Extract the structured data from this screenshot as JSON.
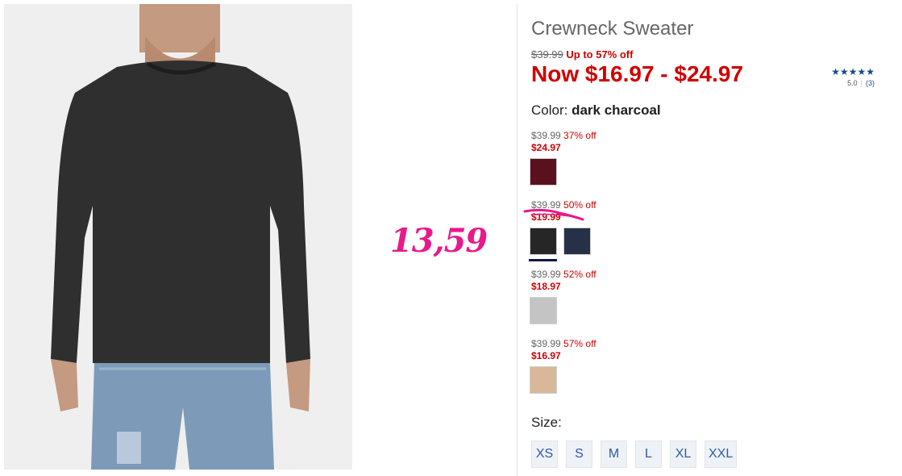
{
  "product": {
    "title": "Crewneck Sweater",
    "list_price": "$39.99",
    "discount_summary": "Up to 57% off",
    "now_range": "Now $16.97 - $24.97",
    "rating": {
      "stars": "★★★★★",
      "score": "5.0",
      "separator": "|",
      "count": "(3)"
    },
    "color_label": "Color:",
    "color_value": "dark charcoal"
  },
  "annotation": "13,59",
  "price_groups": [
    {
      "orig": "$39.99",
      "pct": "37% off",
      "sale": "$24.97",
      "swatches": [
        {
          "name": "burgundy",
          "color": "#5b1020"
        }
      ]
    },
    {
      "orig": "$39.99",
      "pct": "50% off",
      "sale": "$19.99",
      "swatches": [
        {
          "name": "dark charcoal",
          "color": "#262626",
          "selected": true
        },
        {
          "name": "navy",
          "color": "#263148"
        }
      ]
    },
    {
      "orig": "$39.99",
      "pct": "52% off",
      "sale": "$18.97",
      "swatches": [
        {
          "name": "light heather grey",
          "color": "#c4c4c4"
        }
      ]
    },
    {
      "orig": "$39.99",
      "pct": "57% off",
      "sale": "$16.97",
      "swatches": [
        {
          "name": "camel",
          "color": "#d8b898"
        }
      ]
    }
  ],
  "size": {
    "label": "Size:",
    "options": [
      "XS",
      "S",
      "M",
      "L",
      "XL",
      "XXL"
    ]
  },
  "colors": {
    "sale_red": "#d00000",
    "annotation_pink": "#e8198b",
    "link_blue": "#2f5ba8"
  }
}
